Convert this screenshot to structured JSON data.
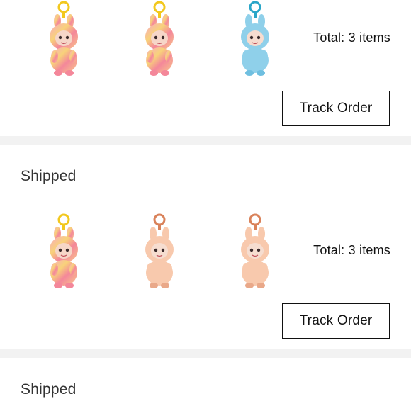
{
  "orders": [
    {
      "status": "",
      "items": [
        {
          "icon": "pink-rainbow-bunny-plush-keychain",
          "colorway": "rainbow"
        },
        {
          "icon": "pink-rainbow-bunny-plush-keychain",
          "colorway": "rainbow"
        },
        {
          "icon": "blue-bunny-plush-keychain",
          "colorway": "blue"
        }
      ],
      "total_label": "Total: 3 items",
      "track_label": "Track Order"
    },
    {
      "status": "Shipped",
      "items": [
        {
          "icon": "pink-rainbow-bunny-plush-keychain",
          "colorway": "rainbow"
        },
        {
          "icon": "peach-bunny-plush-keychain",
          "colorway": "peach"
        },
        {
          "icon": "peach-bunny-plush-keychain",
          "colorway": "peach"
        }
      ],
      "total_label": "Total: 3 items",
      "track_label": "Track Order"
    },
    {
      "status": "Shipped"
    }
  ],
  "colors": {
    "separator": "#f2f2f2",
    "text": "#1a1a1a",
    "button_border": "#111111"
  }
}
